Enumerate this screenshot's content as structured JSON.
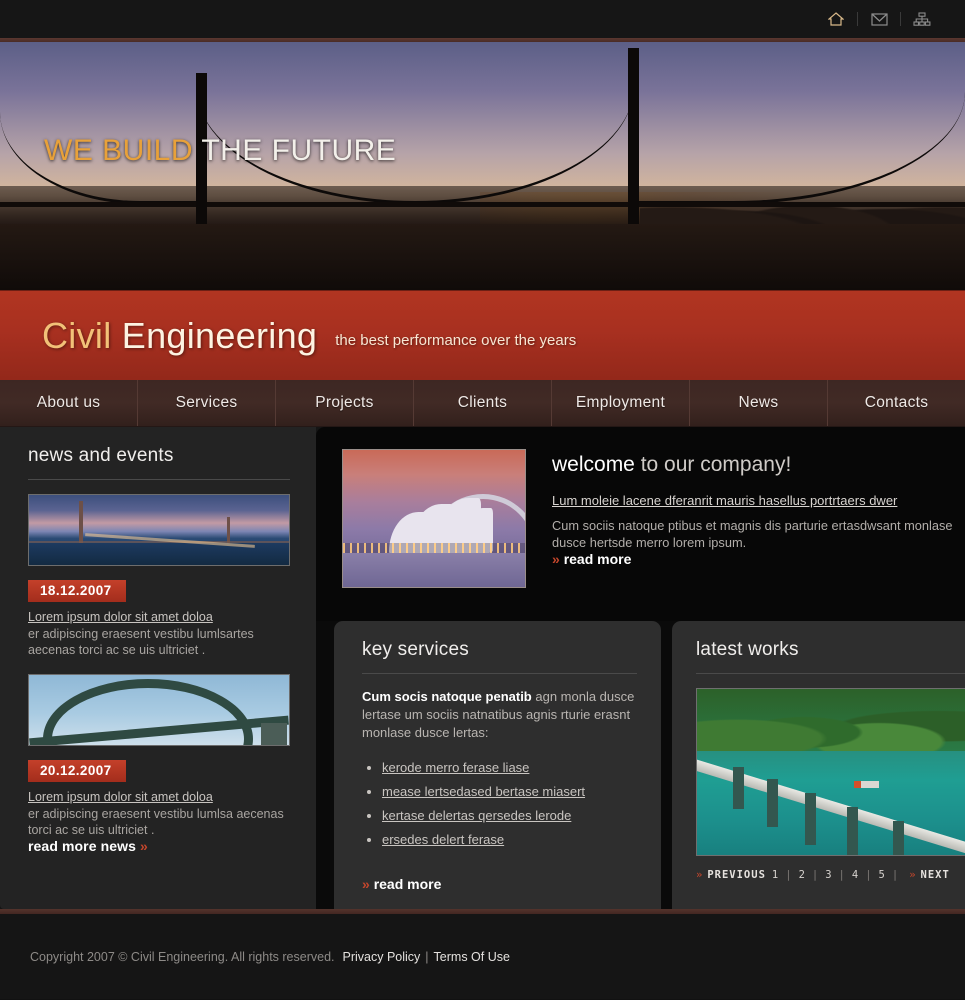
{
  "topbar": {
    "icons": [
      {
        "name": "home-icon",
        "label": "Home"
      },
      {
        "name": "mail-icon",
        "label": "Contact"
      },
      {
        "name": "sitemap-icon",
        "label": "Site map"
      }
    ]
  },
  "hero": {
    "title_accent": "WE BUILD",
    "title_rest": " THE FUTURE"
  },
  "branding": {
    "logo_first": "Civil ",
    "logo_second": "Engineering",
    "tagline": "the best performance over the years"
  },
  "nav": {
    "items": [
      {
        "label": "About us"
      },
      {
        "label": "Services"
      },
      {
        "label": "Projects"
      },
      {
        "label": "Clients"
      },
      {
        "label": "Employment"
      },
      {
        "label": "News"
      },
      {
        "label": "Contacts"
      }
    ]
  },
  "sidebar": {
    "heading": "news and events",
    "items": [
      {
        "date": "18.12.2007",
        "link": "Lorem ipsum dolor sit amet doloa",
        "body": "er adipiscing eraesent vestibu lumlsartes aecenas torci ac se uis ultriciet ."
      },
      {
        "date": "20.12.2007",
        "link": "Lorem ipsum dolor sit amet doloa",
        "body": "er adipiscing eraesent vestibu lumlsa aecenas torci ac se uis ultriciet ."
      }
    ],
    "read_more_news": "read more news",
    "chevron": "»"
  },
  "welcome": {
    "heading_strong": "welcome",
    "heading_rest": " to our company!",
    "lead_link": "Lum moleie lacene dferanrit mauris hasellus portrtaers dwer",
    "body": "Cum sociis natoque ptibus et magnis dis parturie ertasdwsant monlase dusce hertsde merro lorem ipsum.",
    "read_more": "read more",
    "chevron": "»"
  },
  "key_services": {
    "heading": "key services",
    "intro_bold": "Cum socis natoque penatib",
    "intro_rest": " agn monla dusce lertase um sociis natnatibus agnis rturie erasnt monlase dusce lertas:",
    "list": [
      "kerode merro ferase liase",
      "mease lertsedased bertase miasert",
      "kertase delertas qersedes lerode",
      "ersedes delert ferase"
    ],
    "read_more": "read more",
    "chevron": "»"
  },
  "latest_works": {
    "heading": "latest works",
    "pagination": {
      "previous": "PREVIOUS",
      "next": "NEXT",
      "pages": [
        "1",
        "2",
        "3",
        "4",
        "5"
      ],
      "separator": "|",
      "chevron": "»"
    }
  },
  "footer": {
    "copyright": "Copyright 2007 © Civil Engineering. All rights reserved.",
    "privacy": "Privacy Policy",
    "separator": "|",
    "terms": "Terms Of Use"
  },
  "colors": {
    "brand_red": "#a83020",
    "accent_orange": "#e8a13a",
    "logo_gold": "#f2c178",
    "chevron_red": "#c4462c"
  }
}
